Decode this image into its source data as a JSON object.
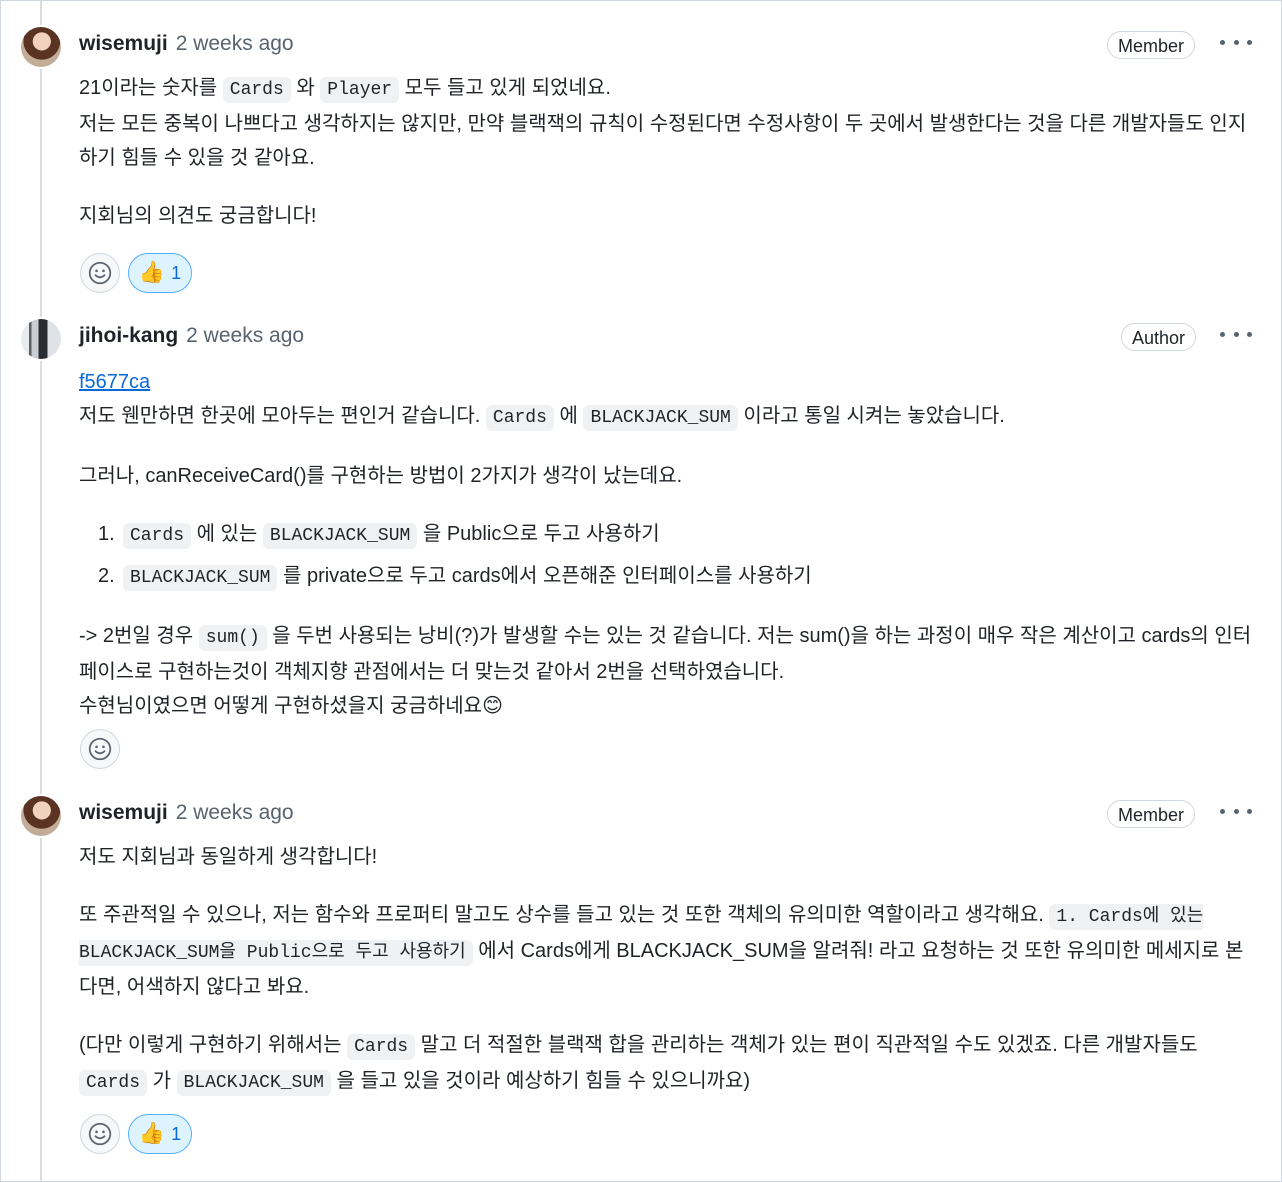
{
  "comments": [
    {
      "author": "wisemuji",
      "time": "2 weeks ago",
      "badge": "Member",
      "l1a": "21이라는 숫자를 ",
      "l1c1": "Cards",
      "l1b": " 와 ",
      "l1c2": "Player",
      "l1d": " 모두 들고 있게 되었네요.",
      "l2": "저는 모든 중복이 나쁘다고 생각하지는 않지만, 만약 블랙잭의 규칙이 수정된다면 수정사항이 두 곳에서 발생한다는 것을 다른 개발자들도 인지하기 힘들 수 있을 것 같아요.",
      "l3": "지회님의 의견도 궁금합니다!",
      "thumbs_count": "1"
    },
    {
      "author": "jihoi-kang",
      "time": "2 weeks ago",
      "badge": "Author",
      "commit": "f5677ca",
      "p1a": "저도 웬만하면 한곳에 모아두는 편인거 같습니다. ",
      "p1c1": "Cards",
      "p1b": " 에 ",
      "p1c2": "BLACKJACK_SUM",
      "p1d": " 이라고 통일 시켜는 놓았습니다.",
      "p2": "그러나, canReceiveCard()를 구현하는 방법이 2가지가 생각이 났는데요.",
      "li1num": "1.",
      "li1c1": "Cards",
      "li1a": " 에 있는 ",
      "li1c2": "BLACKJACK_SUM",
      "li1b": " 을 Public으로 두고 사용하기",
      "li2num": "2.",
      "li2c1": "BLACKJACK_SUM",
      "li2a": " 를 private으로 두고 cards에서 오픈해준 인터페이스를 사용하기",
      "p3a": "-> 2번일 경우 ",
      "p3c": "sum()",
      "p3b": " 을 두번 사용되는 낭비(?)가 발생할 수는 있는 것 같습니다. 저는 sum()을 하는 과정이 매우 작은 계산이고 cards의 인터페이스로 구현하는것이 객체지향 관점에서는 더 맞는것 같아서 2번을 선택하였습니다.",
      "p3d": "수현님이였으면 어떻게 구현하셨을지 궁금하네요",
      "p3emoji": "😊"
    },
    {
      "author": "wisemuji",
      "time": "2 weeks ago",
      "badge": "Member",
      "p1": "저도 지회님과 동일하게 생각합니다!",
      "p2a": "또 주관적일 수 있으나, 저는 함수와 프로퍼티 말고도 상수를 들고 있는 것 또한 객체의 유의미한 역할이라고 생각해요. ",
      "p2c": "1. Cards에 있는 BLACKJACK_SUM을 Public으로 두고 사용하기",
      "p2b": " 에서 Cards에게 BLACKJACK_SUM을 알려줘! 라고 요청하는 것 또한 유의미한 메세지로 본다면, 어색하지 않다고 봐요.",
      "p3a": "(다만 이렇게 구현하기 위해서는 ",
      "p3c1": "Cards",
      "p3b": " 말고 더 적절한 블랙잭 합을 관리하는 객체가 있는 편이 직관적일 수도 있겠죠. 다른 개발자들도 ",
      "p3c2": "Cards",
      "p3d": " 가 ",
      "p3c3": "BLACKJACK_SUM",
      "p3e": " 을 들고 있을 것이라 예상하기 힘들 수 있으니까요)",
      "thumbs_count": "1"
    }
  ],
  "icons": {
    "smile": "smiley-icon",
    "thumbs": "thumbs-up-icon",
    "more": "kebab-horizontal-icon"
  }
}
